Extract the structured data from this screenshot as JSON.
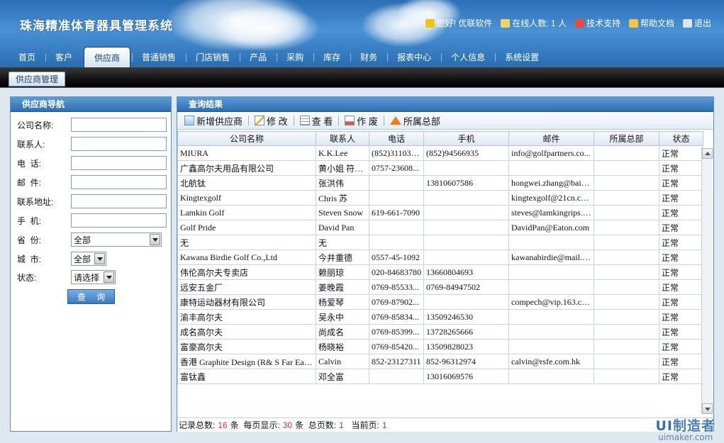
{
  "header": {
    "app_title": "珠海精准体育器具管理系统",
    "links": [
      {
        "label": "您好! 优联软件",
        "icon": "user-icon",
        "color": "#f0c419"
      },
      {
        "label": "在线人数: 1 人",
        "icon": "people-icon",
        "color": "#f1d36b"
      },
      {
        "label": "技术支持",
        "icon": "support-icon",
        "color": "#e74c3c"
      },
      {
        "label": "帮助文档",
        "icon": "mail-icon",
        "color": "#f5c542"
      },
      {
        "label": "退出",
        "icon": "close-box-icon",
        "color": "#d9e6f3"
      }
    ]
  },
  "nav": {
    "items": [
      "首页",
      "客户",
      "供应商",
      "普通销售",
      "门店销售",
      "产品",
      "采购",
      "库存",
      "财务",
      "报表中心",
      "个人信息",
      "系统设置"
    ],
    "active_index": 2
  },
  "subbar": {
    "tab_label": "供应商管理"
  },
  "left_panel": {
    "title": "供应商导航",
    "fields": {
      "company_label": "公司名称:",
      "contact_label": "联系人:",
      "phone_label": "电  话:",
      "email_label": "邮  件:",
      "address_label": "联系地址:",
      "mobile_label": "手  机:",
      "province_label": "省  份:",
      "province_value": "全部",
      "city_label": "城  市:",
      "city_value": "全部",
      "status_label": "状态:",
      "status_value": "请选择"
    },
    "query_button": "查 询"
  },
  "right_panel": {
    "title": "查询结果",
    "toolbar": {
      "add": "新增供应商",
      "edit": "修 改",
      "view": "查 看",
      "void": "作 废",
      "hq": "所属总部"
    },
    "columns": [
      "公司名称",
      "联系人",
      "电话",
      "手机",
      "邮件",
      "所属总部",
      "状态"
    ],
    "rows": [
      [
        "MIURA",
        "K.K.Lee",
        "(852)311033...",
        "(852)94566935",
        "info@golfpartners.co...",
        "",
        "正常"
      ],
      [
        "广鑫高尔夫用品有限公司",
        "黄小姐 符小...",
        "0757-23608...",
        "",
        "",
        "",
        "正常"
      ],
      [
        "北航钛",
        "张洪伟",
        "",
        "13810607586",
        "hongwei.zhang@baim...",
        "",
        "正常"
      ],
      [
        "Kingtexgolf",
        "Chris 苏",
        "",
        "",
        "kingtexgolf@21cn.com",
        "",
        "正常"
      ],
      [
        "Lamkin Golf",
        "Steven Snow",
        "619-661-7090",
        "",
        "steves@lamkingrips.c...",
        "",
        "正常"
      ],
      [
        "Golf Pride",
        "David Pan",
        "",
        "",
        "DavidPan@Eaton.com",
        "",
        "正常"
      ],
      [
        "无",
        "无",
        "",
        "",
        "",
        "",
        "正常"
      ],
      [
        "Kawana Birdie Golf Co.,Ltd",
        "今井重德",
        "0557-45-1092",
        "",
        "kawanabirdie@mail.w...",
        "",
        "正常"
      ],
      [
        "伟伦高尔夫专卖店",
        "赖丽琼",
        "020-84683780",
        "13660804693",
        "",
        "",
        "正常"
      ],
      [
        "远安五金厂",
        "姜晚霞",
        "0769-85533...",
        "0769-84947502",
        "",
        "",
        "正常"
      ],
      [
        "康特运动器材有限公司",
        "杨爱琴",
        "0769-87902...",
        "",
        "compech@vip.163.com",
        "",
        "正常"
      ],
      [
        "渝丰高尔夫",
        "吴永中",
        "0769-85834...",
        "13509246530",
        "",
        "",
        "正常"
      ],
      [
        "成名高尔夫",
        "尚成名",
        "0769-85399...",
        "13728265666",
        "",
        "",
        "正常"
      ],
      [
        "富豪高尔夫",
        "杨晓裕",
        "0769-85420...",
        "13509828023",
        "",
        "",
        "正常"
      ],
      [
        "香港 Graphite Design (R& S Far Eas...",
        "Calvin",
        "852-23127311",
        "852-96312974",
        "calvin@rsfe.com.hk",
        "",
        "正常"
      ],
      [
        "富钛鑫",
        "邓全富",
        "",
        "13016069576",
        "",
        "",
        "正常"
      ]
    ],
    "pager": {
      "total_label": "记录总数:",
      "total": "16",
      "unit1": "条",
      "per_page_label": "每页显示:",
      "per_page": "30",
      "unit2": "条",
      "pages_label": "总页数:",
      "pages": "1",
      "current_label": "当前页:",
      "current": "1"
    }
  },
  "watermark": {
    "brand_prefix": "UI",
    "brand_suffix": "制造者",
    "url": "uimaker.com"
  }
}
